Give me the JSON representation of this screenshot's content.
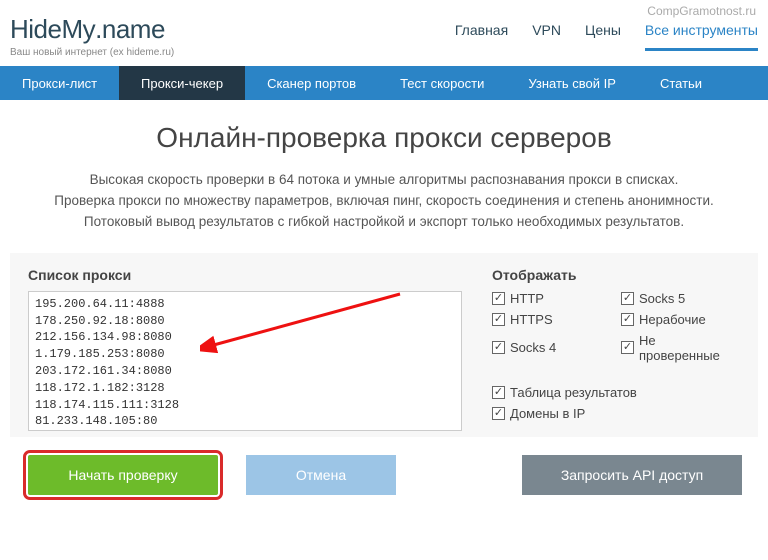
{
  "watermark": "CompGramotnost.ru",
  "logo": {
    "part1": "Hide",
    "part2": "My",
    "part3": ".name"
  },
  "tagline": "Ваш новый интернет (ex hideme.ru)",
  "topnav": {
    "items": [
      "Главная",
      "VPN",
      "Цены",
      "Все инструменты"
    ],
    "active_index": 3
  },
  "subnav": {
    "items": [
      "Прокси-лист",
      "Прокси-чекер",
      "Сканер портов",
      "Тест скорости",
      "Узнать свой IP",
      "Статьи"
    ],
    "active_index": 1
  },
  "page_title": "Онлайн-проверка прокси серверов",
  "description": {
    "l1": "Высокая скорость проверки в 64 потока и умные алгоритмы распознавания прокси в списках.",
    "l2": "Проверка прокси по множеству параметров, включая пинг, скорость соединения и степень анонимности.",
    "l3": "Потоковый вывод результатов с гибкой настройкой и экспорт только необходимых результатов."
  },
  "panel": {
    "list_label": "Список прокси",
    "proxy_list": "195.200.64.11:4888\n178.250.92.18:8080\n212.156.134.98:8080\n1.179.185.253:8080\n203.172.161.34:8080\n118.172.1.182:3128\n118.174.115.111:3128\n81.233.148.105:80",
    "display_label": "Отображать",
    "checks": {
      "http": "HTTP",
      "https": "HTTPS",
      "socks4": "Socks 4",
      "socks5": "Socks 5",
      "broken": "Нерабочие",
      "unchecked": "Не проверенные",
      "table": "Таблица результатов",
      "domains": "Домены в IP"
    }
  },
  "buttons": {
    "start": "Начать проверку",
    "cancel": "Отмена",
    "api": "Запросить API доступ"
  },
  "tick": "✓"
}
